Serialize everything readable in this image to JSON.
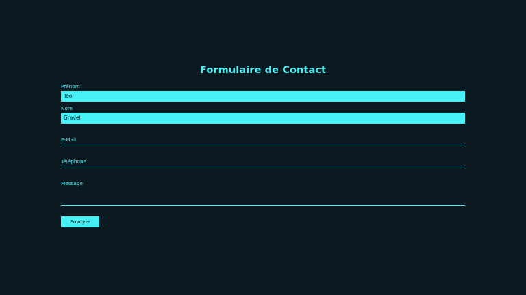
{
  "form": {
    "title": "Formulaire de Contact",
    "fields": {
      "prenom": {
        "label": "Prénom",
        "value": "Téo"
      },
      "nom": {
        "label": "Nom",
        "value": "Gravel"
      },
      "email": {
        "label": "E-Mail",
        "value": ""
      },
      "telephone": {
        "label": "Téléphone",
        "value": ""
      },
      "message": {
        "label": "Message",
        "value": ""
      }
    },
    "submit_label": "Envoyer"
  },
  "colors": {
    "background": "#0a1a20",
    "accent": "#46f0f5"
  }
}
